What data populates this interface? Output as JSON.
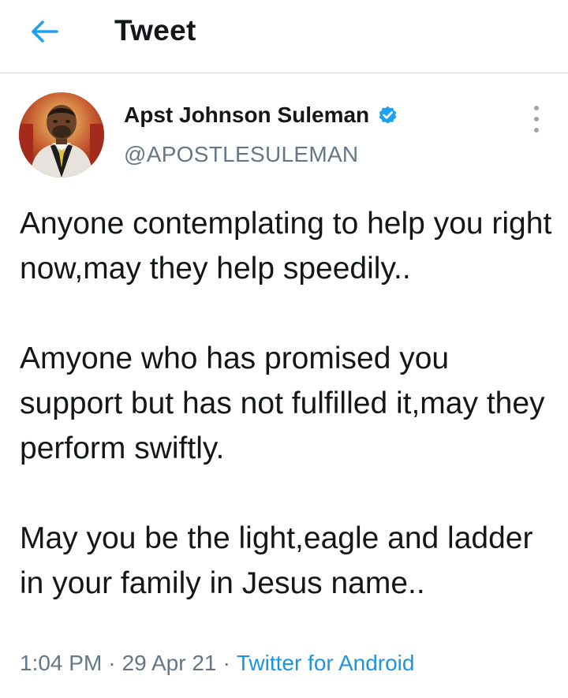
{
  "header": {
    "title": "Tweet",
    "back_icon": "arrow-left-icon",
    "accent_color": "#1da1f2"
  },
  "tweet": {
    "author": {
      "name": "Apst Johnson Suleman",
      "handle": "@APOSTLESULEMAN",
      "verified_icon": "verified-badge-icon",
      "verified_color": "#1da1f2"
    },
    "more_icon": "vertical-ellipsis-icon",
    "paragraphs": [
      "Anyone contemplating to help you right now,may they help speedily..",
      "Amyone who has promised you support but has not fulfilled it,may they perform swiftly.",
      "May you be the light,eagle and ladder in your family in Jesus name.."
    ],
    "meta": {
      "time": "1:04 PM",
      "date": "29 Apr 21",
      "separator": "·",
      "source": "Twitter for Android",
      "source_color": "#1b95e0"
    }
  }
}
